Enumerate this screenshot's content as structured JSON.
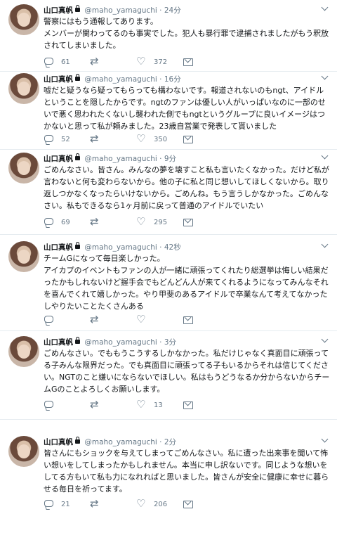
{
  "tweets": [
    {
      "name": "山口真帆",
      "handle": "@maho_yamaguchi",
      "dot": "·",
      "time": "24分",
      "text": "警察にはもう通報してあります。\nメンバーが関わってるのも事実でした。犯人も暴行罪で逮捕されましたがもう釈放されてしまいました。",
      "replies": "61",
      "retweets": "",
      "likes": "372"
    },
    {
      "name": "山口真帆",
      "handle": "@maho_yamaguchi",
      "dot": "·",
      "time": "16分",
      "text": "嘘だと疑うなら疑ってもらっても構わないです。報道されないのもngt、アイドルということを隠したからです。ngtのファンは優しい人がいっぱいなのに一部のせいで悪く思われたくないし襲われた側でもngtというグループに良いイメージはつかないと思って私が頼みました。23歳自営業で発表して貰いました",
      "replies": "52",
      "retweets": "",
      "likes": "350"
    },
    {
      "name": "山口真帆",
      "handle": "@maho_yamaguchi",
      "dot": "·",
      "time": "9分",
      "text": "ごめんなさい。皆さん。みんなの夢を壊すこと私も言いたくなかった。だけど私が言わないと何も変わらないから。他の子に私と同じ想いしてほしくないから。取り返しつかなくなったらいけないから。ごめんね。もう言うしかなかった。ごめんなさい。私もできるなら1ヶ月前に戻って普通のアイドルでいたい",
      "replies": "69",
      "retweets": "",
      "likes": "295"
    },
    {
      "name": "山口真帆",
      "handle": "@maho_yamaguchi",
      "dot": "·",
      "time": "42秒",
      "text": "チームGになって毎日楽しかった。\nアイカプのイベントもファンの人が一緒に頑張ってくれたり総選挙は悔しい結果だったかもしれないけど握手会でもどんどん人が来てくれるようになってみんなそれを喜んでくれて嬉しかった。やり甲斐のあるアイドルで卒業なんて考えてなかったしやりたいことたくさんある",
      "replies": "",
      "retweets": "",
      "likes": ""
    },
    {
      "name": "山口真帆",
      "handle": "@maho_yamaguchi",
      "dot": "·",
      "time": "3分",
      "text": "ごめんなさい。でももうこうするしかなかった。私だけじゃなく真面目に頑張ってる子みんな限界だった。でも真面目に頑張ってる子もいるからそれは信じてください。NGTのこと嫌いにならないでほしい。私はもうどうなるか分からないからチームGのことよろしくお願いします。",
      "replies": "",
      "retweets": "",
      "likes": "13"
    },
    {
      "name": "山口真帆",
      "handle": "@maho_yamaguchi",
      "dot": "·",
      "time": "2分",
      "text": "皆さんにもショックを与えてしまってごめんなさい。私に遭った出来事を聞いて怖い想いをしてしまったかもしれません。本当に申し訳ないです。同じような想いをしてる方もいて私も力になれればと思いました。皆さんが安全に健康に幸せに暮らせる毎日を祈ってます。",
      "replies": "21",
      "retweets": "",
      "likes": "206"
    }
  ]
}
